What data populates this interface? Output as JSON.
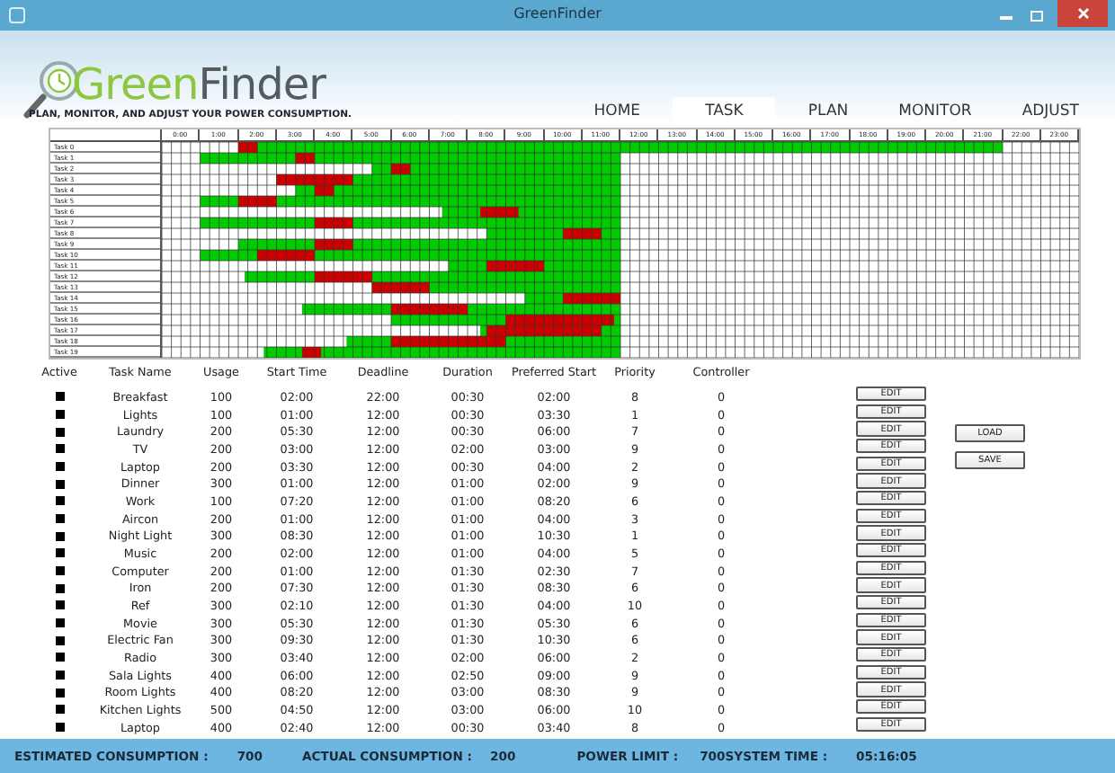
{
  "window": {
    "title": "GreenFinder"
  },
  "header": {
    "logo_first": "Green",
    "logo_second": "Finder",
    "tagline": "PLAN, MONITOR, AND ADJUST YOUR POWER CONSUMPTION."
  },
  "tabs": [
    {
      "label": "HOME",
      "selected": false
    },
    {
      "label": "TASK",
      "selected": true
    },
    {
      "label": "PLAN",
      "selected": false
    },
    {
      "label": "MONITOR",
      "selected": false
    },
    {
      "label": "ADJUST",
      "selected": false
    }
  ],
  "schedule": {
    "hours": [
      "0:00",
      "1:00",
      "2:00",
      "3:00",
      "4:00",
      "5:00",
      "6:00",
      "7:00",
      "8:00",
      "9:00",
      "10:00",
      "11:00",
      "12:00",
      "13:00",
      "14:00",
      "15:00",
      "16:00",
      "17:00",
      "18:00",
      "19:00",
      "20:00",
      "21:00",
      "22:00",
      "23:00"
    ],
    "row_labels": [
      "Task 0",
      "Task 1",
      "Task 2",
      "Task 3",
      "Task 4",
      "Task 5",
      "Task 6",
      "Task 7",
      "Task 8",
      "Task 9",
      "Task 10",
      "Task 11",
      "Task 12",
      "Task 13",
      "Task 14",
      "Task 15",
      "Task 16",
      "Task 17",
      "Task 18",
      "Task 19"
    ]
  },
  "table": {
    "columns": [
      "Active",
      "Task Name",
      "Usage",
      "Start Time",
      "Deadline",
      "Duration",
      "Preferred Start",
      "Priority",
      "Controller"
    ],
    "rows": [
      {
        "task_name": "Breakfast",
        "usage": "100",
        "start_time": "02:00",
        "deadline": "22:00",
        "duration": "00:30",
        "preferred_start": "02:00",
        "priority": "8",
        "controller": "0",
        "button": "EDIT"
      },
      {
        "task_name": "Lights",
        "usage": "100",
        "start_time": "01:00",
        "deadline": "12:00",
        "duration": "00:30",
        "preferred_start": "03:30",
        "priority": "1",
        "controller": "0",
        "button": "EDIT"
      },
      {
        "task_name": "Laundry",
        "usage": "200",
        "start_time": "05:30",
        "deadline": "12:00",
        "duration": "00:30",
        "preferred_start": "06:00",
        "priority": "7",
        "controller": "0",
        "button": "EDIT"
      },
      {
        "task_name": "TV",
        "usage": "200",
        "start_time": "03:00",
        "deadline": "12:00",
        "duration": "02:00",
        "preferred_start": "03:00",
        "priority": "9",
        "controller": "0",
        "button": "EDIT"
      },
      {
        "task_name": "Laptop",
        "usage": "200",
        "start_time": "03:30",
        "deadline": "12:00",
        "duration": "00:30",
        "preferred_start": "04:00",
        "priority": "2",
        "controller": "0",
        "button": "EDIT"
      },
      {
        "task_name": "Dinner",
        "usage": "300",
        "start_time": "01:00",
        "deadline": "12:00",
        "duration": "01:00",
        "preferred_start": "02:00",
        "priority": "9",
        "controller": "0",
        "button": "EDIT"
      },
      {
        "task_name": "Work",
        "usage": "100",
        "start_time": "07:20",
        "deadline": "12:00",
        "duration": "01:00",
        "preferred_start": "08:20",
        "priority": "6",
        "controller": "0",
        "button": "EDIT"
      },
      {
        "task_name": "Aircon",
        "usage": "200",
        "start_time": "01:00",
        "deadline": "12:00",
        "duration": "01:00",
        "preferred_start": "04:00",
        "priority": "3",
        "controller": "0",
        "button": "EDIT"
      },
      {
        "task_name": "Night Light",
        "usage": "300",
        "start_time": "08:30",
        "deadline": "12:00",
        "duration": "01:00",
        "preferred_start": "10:30",
        "priority": "1",
        "controller": "0",
        "button": "EDIT"
      },
      {
        "task_name": "Music",
        "usage": "200",
        "start_time": "02:00",
        "deadline": "12:00",
        "duration": "01:00",
        "preferred_start": "04:00",
        "priority": "5",
        "controller": "0",
        "button": "EDIT"
      },
      {
        "task_name": "Computer",
        "usage": "200",
        "start_time": "01:00",
        "deadline": "12:00",
        "duration": "01:30",
        "preferred_start": "02:30",
        "priority": "7",
        "controller": "0",
        "button": "EDIT"
      },
      {
        "task_name": "Iron",
        "usage": "200",
        "start_time": "07:30",
        "deadline": "12:00",
        "duration": "01:30",
        "preferred_start": "08:30",
        "priority": "6",
        "controller": "0",
        "button": "EDIT"
      },
      {
        "task_name": "Ref",
        "usage": "300",
        "start_time": "02:10",
        "deadline": "12:00",
        "duration": "01:30",
        "preferred_start": "04:00",
        "priority": "10",
        "controller": "0",
        "button": "EDIT"
      },
      {
        "task_name": "Movie",
        "usage": "300",
        "start_time": "05:30",
        "deadline": "12:00",
        "duration": "01:30",
        "preferred_start": "05:30",
        "priority": "6",
        "controller": "0",
        "button": "EDIT"
      },
      {
        "task_name": "Electric Fan",
        "usage": "300",
        "start_time": "09:30",
        "deadline": "12:00",
        "duration": "01:30",
        "preferred_start": "10:30",
        "priority": "6",
        "controller": "0",
        "button": "EDIT"
      },
      {
        "task_name": "Radio",
        "usage": "300",
        "start_time": "03:40",
        "deadline": "12:00",
        "duration": "02:00",
        "preferred_start": "06:00",
        "priority": "2",
        "controller": "0",
        "button": "EDIT"
      },
      {
        "task_name": "Sala Lights",
        "usage": "400",
        "start_time": "06:00",
        "deadline": "12:00",
        "duration": "02:50",
        "preferred_start": "09:00",
        "priority": "9",
        "controller": "0",
        "button": "EDIT"
      },
      {
        "task_name": "Room Lights",
        "usage": "400",
        "start_time": "08:20",
        "deadline": "12:00",
        "duration": "03:00",
        "preferred_start": "08:30",
        "priority": "9",
        "controller": "0",
        "button": "EDIT"
      },
      {
        "task_name": "Kitchen Lights",
        "usage": "500",
        "start_time": "04:50",
        "deadline": "12:00",
        "duration": "03:00",
        "preferred_start": "06:00",
        "priority": "10",
        "controller": "0",
        "button": "EDIT"
      },
      {
        "task_name": "Laptop",
        "usage": "400",
        "start_time": "02:40",
        "deadline": "12:00",
        "duration": "00:30",
        "preferred_start": "03:40",
        "priority": "8",
        "controller": "0",
        "button": "EDIT"
      }
    ]
  },
  "side_buttons": [
    "LOAD",
    "SAVE"
  ],
  "status_bar": [
    {
      "label": "ESTIMATED CONSUMPTION :",
      "value": "700"
    },
    {
      "label": "ACTUAL CONSUMPTION :",
      "value": "200"
    },
    {
      "label": "POWER LIMIT :",
      "value": "700"
    },
    {
      "label": "SYSTEM TIME :",
      "value": "05:16:05"
    }
  ]
}
